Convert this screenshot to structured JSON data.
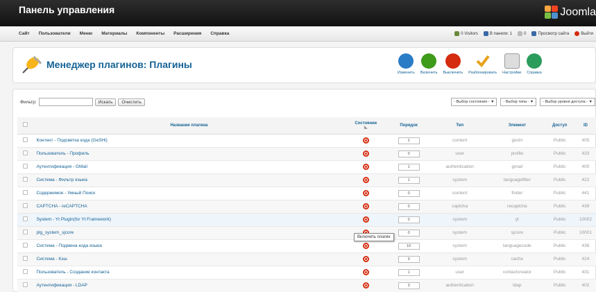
{
  "header": {
    "title": "Панель управления",
    "logo_text": "Joomla"
  },
  "menu": [
    "Сайт",
    "Пользователи",
    "Меню",
    "Материалы",
    "Компоненты",
    "Расширения",
    "Справка"
  ],
  "status": {
    "visitors": "0 Visitors",
    "admins": "В панели: 1",
    "messages": "0",
    "preview": "Просмотр сайта",
    "logout": "Выйти"
  },
  "toolbar": {
    "title": "Менеджер плагинов: Плагины",
    "buttons": [
      {
        "label": "Изменить",
        "color": "#2b7cc7"
      },
      {
        "label": "Включить",
        "color": "#3f9b1a"
      },
      {
        "label": "Выключить",
        "color": "#d52b0e"
      },
      {
        "label": "Разблокировать",
        "color": "#e8a21a"
      },
      {
        "label": "Настройки",
        "color": "#888888"
      },
      {
        "label": "Справка",
        "color": "#2b9c5c"
      }
    ]
  },
  "filter": {
    "label": "Фильтр:",
    "search_button": "Искать",
    "clear_button": "Очистить",
    "selects": [
      "- Выбор состояния -",
      "- Выбор типа -",
      "- Выбор уровня доступа -"
    ]
  },
  "table": {
    "headers": {
      "name": "Название плагина",
      "state": "Состояние",
      "order": "Порядок",
      "type": "Тип",
      "element": "Элемент",
      "access": "Доступ",
      "id": "ID"
    },
    "rows": [
      {
        "name": "Контент - Подсветка кода (GeSHi)",
        "order": "2",
        "type": "content",
        "element": "geshi",
        "access": "Public",
        "id": "405"
      },
      {
        "name": "Пользователь - Профиль",
        "order": "0",
        "type": "user",
        "element": "profile",
        "access": "Public",
        "id": "433"
      },
      {
        "name": "Аутентификация - GMail",
        "order": "1",
        "type": "authentication",
        "element": "gmail",
        "access": "Public",
        "id": "400"
      },
      {
        "name": "Система - Фильтр языка",
        "order": "1",
        "type": "system",
        "element": "languagefilter",
        "access": "Public",
        "id": "422"
      },
      {
        "name": "Содержимое - Умный Поиск",
        "order": "0",
        "type": "content",
        "element": "finder",
        "access": "Public",
        "id": "441"
      },
      {
        "name": "CAPTCHA - reCAPTCHA",
        "order": "0",
        "type": "captcha",
        "element": "recaptcha",
        "access": "Public",
        "id": "439"
      },
      {
        "name": "System - Yt Plugin(for Yt Framework)",
        "order": "0",
        "type": "system",
        "element": "yt",
        "access": "Public",
        "id": "10002"
      },
      {
        "name": "plg_system_sjcore",
        "order": "0",
        "type": "system",
        "element": "sjcore",
        "access": "Public",
        "id": "10001"
      },
      {
        "name": "Система - Подмена кода языка",
        "order": "10",
        "type": "system",
        "element": "languagecode",
        "access": "Public",
        "id": "436"
      },
      {
        "name": "Система - Кэш",
        "order": "9",
        "type": "system",
        "element": "cache",
        "access": "Public",
        "id": "424"
      },
      {
        "name": "Пользователь - Создание контакта",
        "order": "1",
        "type": "user",
        "element": "contactcreator",
        "access": "Public",
        "id": "431"
      },
      {
        "name": "Аутентификация - LDAP",
        "order": "3",
        "type": "authentication",
        "element": "ldap",
        "access": "Public",
        "id": "402"
      }
    ]
  },
  "tooltip": "Включить плагин"
}
